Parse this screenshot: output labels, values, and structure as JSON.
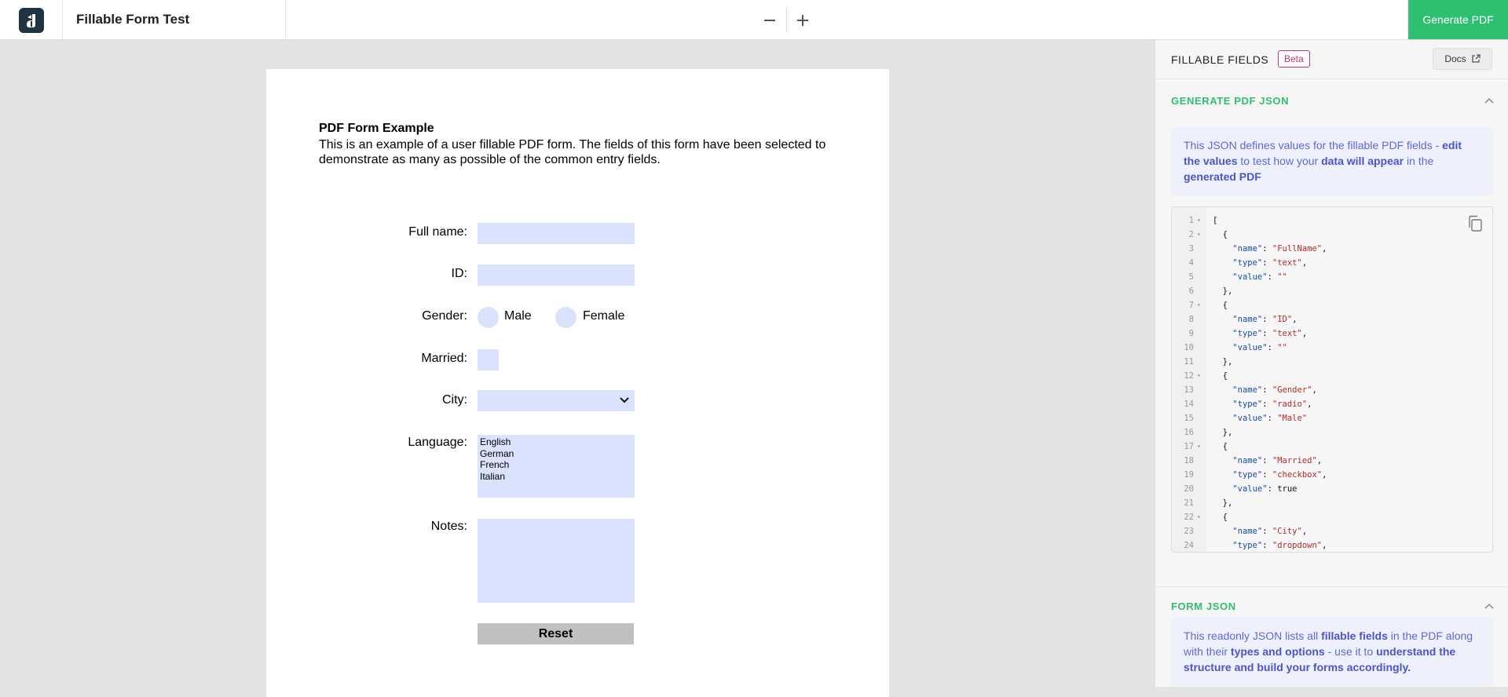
{
  "header": {
    "app_title": "Fillable Form Test",
    "generate_button": "Generate PDF",
    "zoom_out_icon": "minus-icon",
    "zoom_in_icon": "plus-icon",
    "accent_color": "#2fbf71"
  },
  "form": {
    "title": "PDF Form Example",
    "description": "This is an example of a user fillable PDF form. The fields of this form have been selected to demonstrate as many as possible of the common entry fields.",
    "labels": {
      "full_name": "Full name:",
      "id": "ID:",
      "gender": "Gender:",
      "married": "Married:",
      "city": "City:",
      "language": "Language:",
      "notes": "Notes:"
    },
    "gender_options": [
      "Male",
      "Female"
    ],
    "languages": [
      "English",
      "German",
      "French",
      "Italian"
    ],
    "reset_label": "Reset",
    "field_color": "#dbe2fd"
  },
  "panel": {
    "title": "FILLABLE FIELDS",
    "beta": "Beta",
    "docs": "Docs",
    "sections": [
      {
        "title": "GENERATE PDF JSON",
        "info_parts": [
          "This JSON defines values for the fillable PDF fields - ",
          "edit the values",
          " to test how your ",
          "data will appear",
          " in the ",
          "generated PDF"
        ]
      },
      {
        "title": "FORM JSON",
        "info_parts": [
          "This readonly JSON lists all ",
          "fillable fields",
          " in the PDF along with their ",
          "types and options",
          " - use it to ",
          "understand the structure and build your forms accordingly."
        ]
      }
    ],
    "code_lines": [
      {
        "n": "1",
        "fold": true,
        "text": "["
      },
      {
        "n": "2",
        "fold": true,
        "text": "  {"
      },
      {
        "n": "3",
        "fold": false,
        "key": "\"name\"",
        "val": "\"FullName\"",
        "tail": ","
      },
      {
        "n": "4",
        "fold": false,
        "key": "\"type\"",
        "val": "\"text\"",
        "tail": ","
      },
      {
        "n": "5",
        "fold": false,
        "key": "\"value\"",
        "val": "\"\"",
        "tail": ""
      },
      {
        "n": "6",
        "fold": false,
        "text": "  },"
      },
      {
        "n": "7",
        "fold": true,
        "text": "  {"
      },
      {
        "n": "8",
        "fold": false,
        "key": "\"name\"",
        "val": "\"ID\"",
        "tail": ","
      },
      {
        "n": "9",
        "fold": false,
        "key": "\"type\"",
        "val": "\"text\"",
        "tail": ","
      },
      {
        "n": "10",
        "fold": false,
        "key": "\"value\"",
        "val": "\"\"",
        "tail": ""
      },
      {
        "n": "11",
        "fold": false,
        "text": "  },"
      },
      {
        "n": "12",
        "fold": true,
        "text": "  {"
      },
      {
        "n": "13",
        "fold": false,
        "key": "\"name\"",
        "val": "\"Gender\"",
        "tail": ","
      },
      {
        "n": "14",
        "fold": false,
        "key": "\"type\"",
        "val": "\"radio\"",
        "tail": ","
      },
      {
        "n": "15",
        "fold": false,
        "key": "\"value\"",
        "val": "\"Male\"",
        "tail": ""
      },
      {
        "n": "16",
        "fold": false,
        "text": "  },"
      },
      {
        "n": "17",
        "fold": true,
        "text": "  {"
      },
      {
        "n": "18",
        "fold": false,
        "key": "\"name\"",
        "val": "\"Married\"",
        "tail": ","
      },
      {
        "n": "19",
        "fold": false,
        "key": "\"type\"",
        "val": "\"checkbox\"",
        "tail": ","
      },
      {
        "n": "20",
        "fold": false,
        "key": "\"value\"",
        "plain": "true",
        "tail": ""
      },
      {
        "n": "21",
        "fold": false,
        "text": "  },"
      },
      {
        "n": "22",
        "fold": true,
        "text": "  {"
      },
      {
        "n": "23",
        "fold": false,
        "key": "\"name\"",
        "val": "\"City\"",
        "tail": ","
      },
      {
        "n": "24",
        "fold": false,
        "key": "\"type\"",
        "val": "\"dropdown\"",
        "tail": ","
      }
    ]
  }
}
